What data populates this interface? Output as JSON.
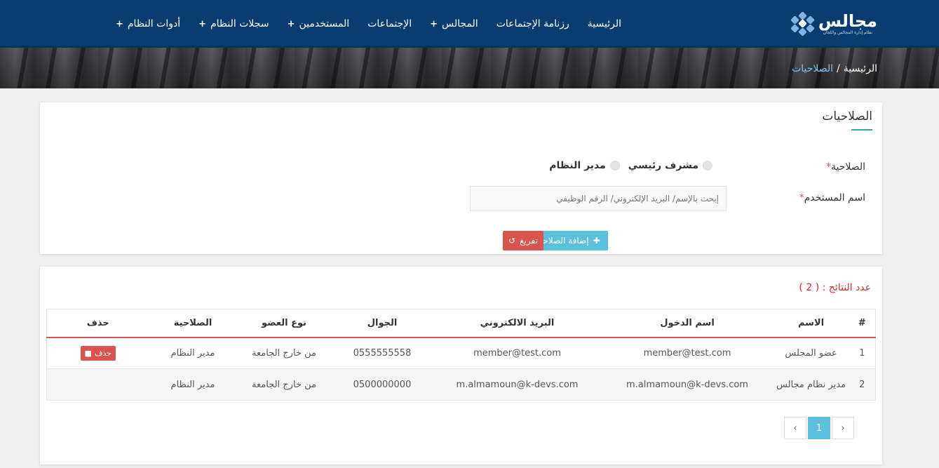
{
  "logo": {
    "word": "مجالس",
    "sub": "نظام إدارة المجالس واللجان"
  },
  "nav": {
    "items": [
      {
        "label": "الرئيسية",
        "plus": ""
      },
      {
        "label": "رزنامة الإجتماعات",
        "plus": ""
      },
      {
        "label": "المجالس",
        "plus": "+"
      },
      {
        "label": "الإجتماعات",
        "plus": ""
      },
      {
        "label": "المستخدمين",
        "plus": "+"
      },
      {
        "label": "سجلات النظام",
        "plus": "+"
      },
      {
        "label": "أدوات النظام",
        "plus": "+"
      }
    ]
  },
  "breadcrumb": {
    "home": "الرئيسية",
    "sep": "/",
    "current": "الصلاحيات"
  },
  "form": {
    "title": "الصلاحيات",
    "permission_label": "الصلاحية",
    "required_mark": "*",
    "radio_1": "مشرف رئيسي",
    "radio_2": "مدير النظام",
    "user_label": "اسم المستخدم",
    "search_placeholder": "إبحث بالإسم/ البريد الإلكتروني/ الرقم الوظيفي",
    "add_button": "إضافة الصلاحية",
    "clear_button": "تفريغ"
  },
  "results": {
    "count_label": "عدد النتائج : ( 2 )",
    "headers": [
      "#",
      "الاسم",
      "اسم الدخول",
      "البريد الالكتروني",
      "الجوال",
      "نوع العضو",
      "الصلاحية",
      "حذف"
    ],
    "rows": [
      {
        "num": "1",
        "name": "عضو المجلس",
        "login": "member@test.com",
        "email": "member@test.com",
        "mobile": "0555555558",
        "type": "من خارج الجامعة",
        "permission": "مدير النظام",
        "delete": "حذف"
      },
      {
        "num": "2",
        "name": "مدير نظام مجالس",
        "login": "m.almamoun@k-devs.com",
        "email": "m.almamoun@k-devs.com",
        "mobile": "0500000000",
        "type": "من خارج الجامعة",
        "permission": "مدير النظام",
        "delete": ""
      }
    ]
  },
  "pager": {
    "prev": "‹",
    "current": "1",
    "next": "›"
  },
  "colors": {
    "nav_bg": "#0b3c71",
    "accent": "#5bc0de",
    "danger": "#d9534f"
  }
}
